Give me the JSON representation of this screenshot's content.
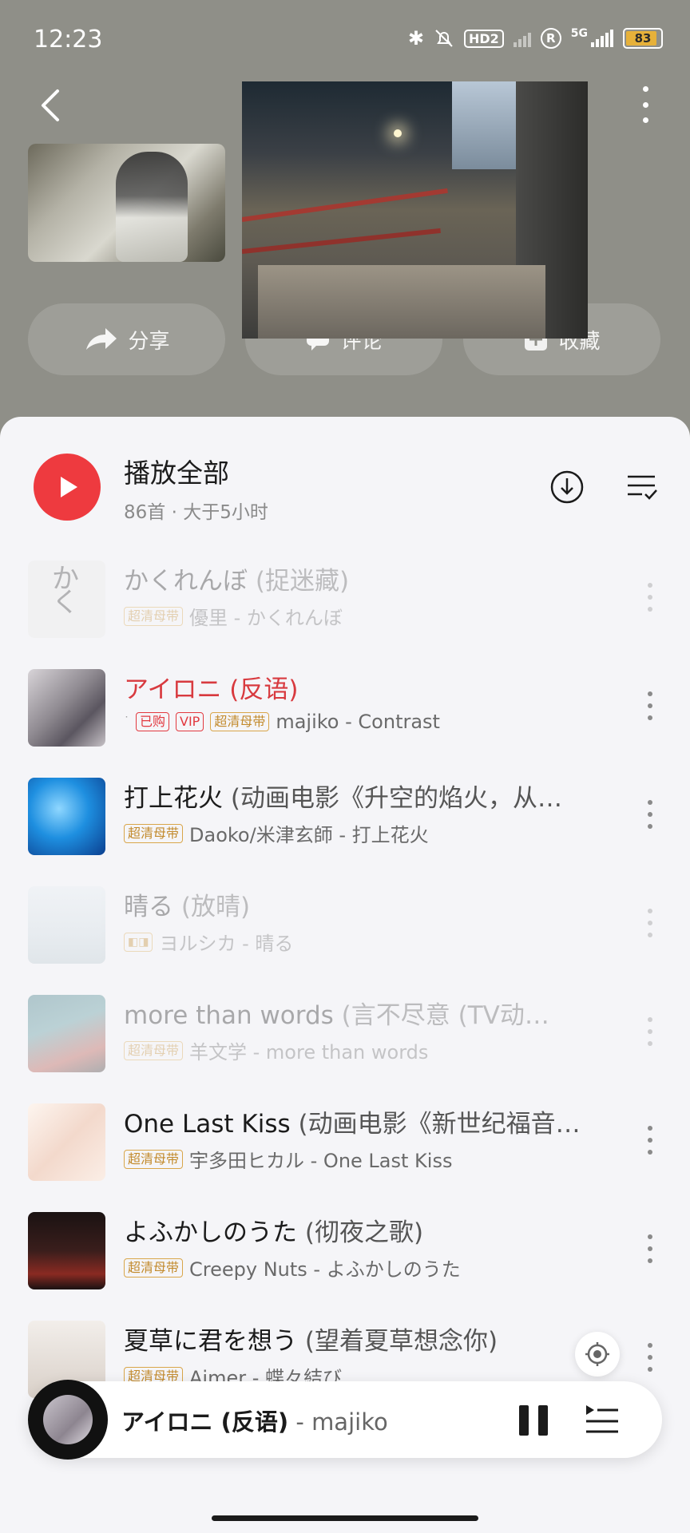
{
  "status_bar": {
    "time": "12:23",
    "hd_badge": "HD2",
    "network": "5G",
    "battery": "83"
  },
  "header": {
    "actions": [
      {
        "label": "分享",
        "icon": "share-icon"
      },
      {
        "label": "评论",
        "icon": "comment-icon"
      },
      {
        "label": "收藏",
        "icon": "collect-icon"
      }
    ]
  },
  "play_all": {
    "title": "播放全部",
    "subtitle": "86首 · 大于5小时"
  },
  "songs": [
    {
      "title": "かくれんぼ",
      "alt": " (捉迷藏)",
      "tags": [
        "超清母带"
      ],
      "meta": "優里 - かくれんぼ",
      "state": "dim"
    },
    {
      "title": "アイロニ",
      "alt": " (反语)",
      "tags": [
        "已购",
        "VIP",
        "超清母带"
      ],
      "meta": "majiko - Contrast",
      "state": "playing"
    },
    {
      "title": "打上花火",
      "alt": " (动画电影《升空的焰火，从…",
      "tags": [
        "超清母带"
      ],
      "meta": "Daoko/米津玄師 - 打上花火",
      "state": "normal"
    },
    {
      "title": "晴る",
      "alt": " (放晴)",
      "tags": [],
      "meta": "ヨルシカ - 晴る",
      "state": "dim"
    },
    {
      "title": "more than words",
      "alt": " (言不尽意 (TV动…",
      "tags": [
        "超清母带"
      ],
      "meta": "羊文学 - more than words",
      "state": "dim"
    },
    {
      "title": "One Last Kiss",
      "alt": " (动画电影《新世纪福音…",
      "tags": [
        "超清母带"
      ],
      "meta": "宇多田ヒカル - One Last Kiss",
      "state": "normal"
    },
    {
      "title": "よふかしのうた",
      "alt": " (彻夜之歌)",
      "tags": [
        "超清母带"
      ],
      "meta": "Creepy Nuts - よふかしのうた",
      "state": "normal"
    },
    {
      "title": "夏草に君を想う",
      "alt": " (望着夏草想念你)",
      "tags": [
        "超清母带"
      ],
      "meta": "Aimer - 蝶々結び",
      "state": "normal"
    }
  ],
  "mini_player": {
    "title": "アイロニ (反语)",
    "separator": " - ",
    "artist": "majiko"
  },
  "colors": {
    "accent": "#ee3a3f",
    "tag_gold": "#c28a2c",
    "sheet_bg": "#f5f5f8"
  }
}
